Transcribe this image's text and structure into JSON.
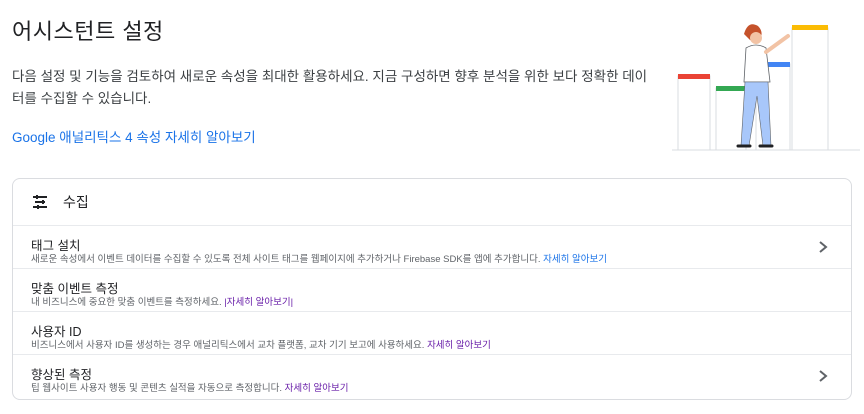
{
  "header": {
    "title": "어시스턴트 설정",
    "description": "다음 설정 및 기능을 검토하여 새로운 속성을 최대한 활용하세요. 지금 구성하면 향후 분석을 위한 보다 정확한 데이터를 수집할 수 있습니다.",
    "link": "Google 애널리틱스 4 속성 자세히 알아보기"
  },
  "section": {
    "title": "수집",
    "icon": "filter-list-icon",
    "rows": [
      {
        "title": "태그 설치",
        "subtitle": "새로운 속성에서 이벤트 데이터를 수집할 수 있도록 전체 사이트 태그를 웹페이지에 추가하거나 Firebase SDK를 앱에 추가합니다. ",
        "link": "자세히 알아보기",
        "has_chevron": true
      },
      {
        "title": "맞춤 이벤트 측정",
        "subtitle": "내 비즈니스에 중요한 맞춤 이벤트를 측정하세요. ",
        "link": "|자세히 알아보기|",
        "has_chevron": false
      },
      {
        "title": "사용자 ID",
        "subtitle": "비즈니스에서 사용자 ID를 생성하는 경우 애널리틱스에서 교차 플랫폼, 교차 기기 보고에 사용하세요. ",
        "link": "자세히 알아보기",
        "has_chevron": false
      },
      {
        "title": "향상된 측정",
        "subtitle": "팁 웹사이트 사용자 행동 및 콘텐츠 실적을 자동으로 측정합니다. ",
        "link": "자세히 알아보기",
        "has_chevron": true
      }
    ]
  },
  "colors": {
    "link": "#1a73e8",
    "visited_link": "#681da8",
    "red": "#ea4335",
    "green": "#34a853",
    "blue": "#4285f4",
    "yellow": "#fbbc04"
  }
}
